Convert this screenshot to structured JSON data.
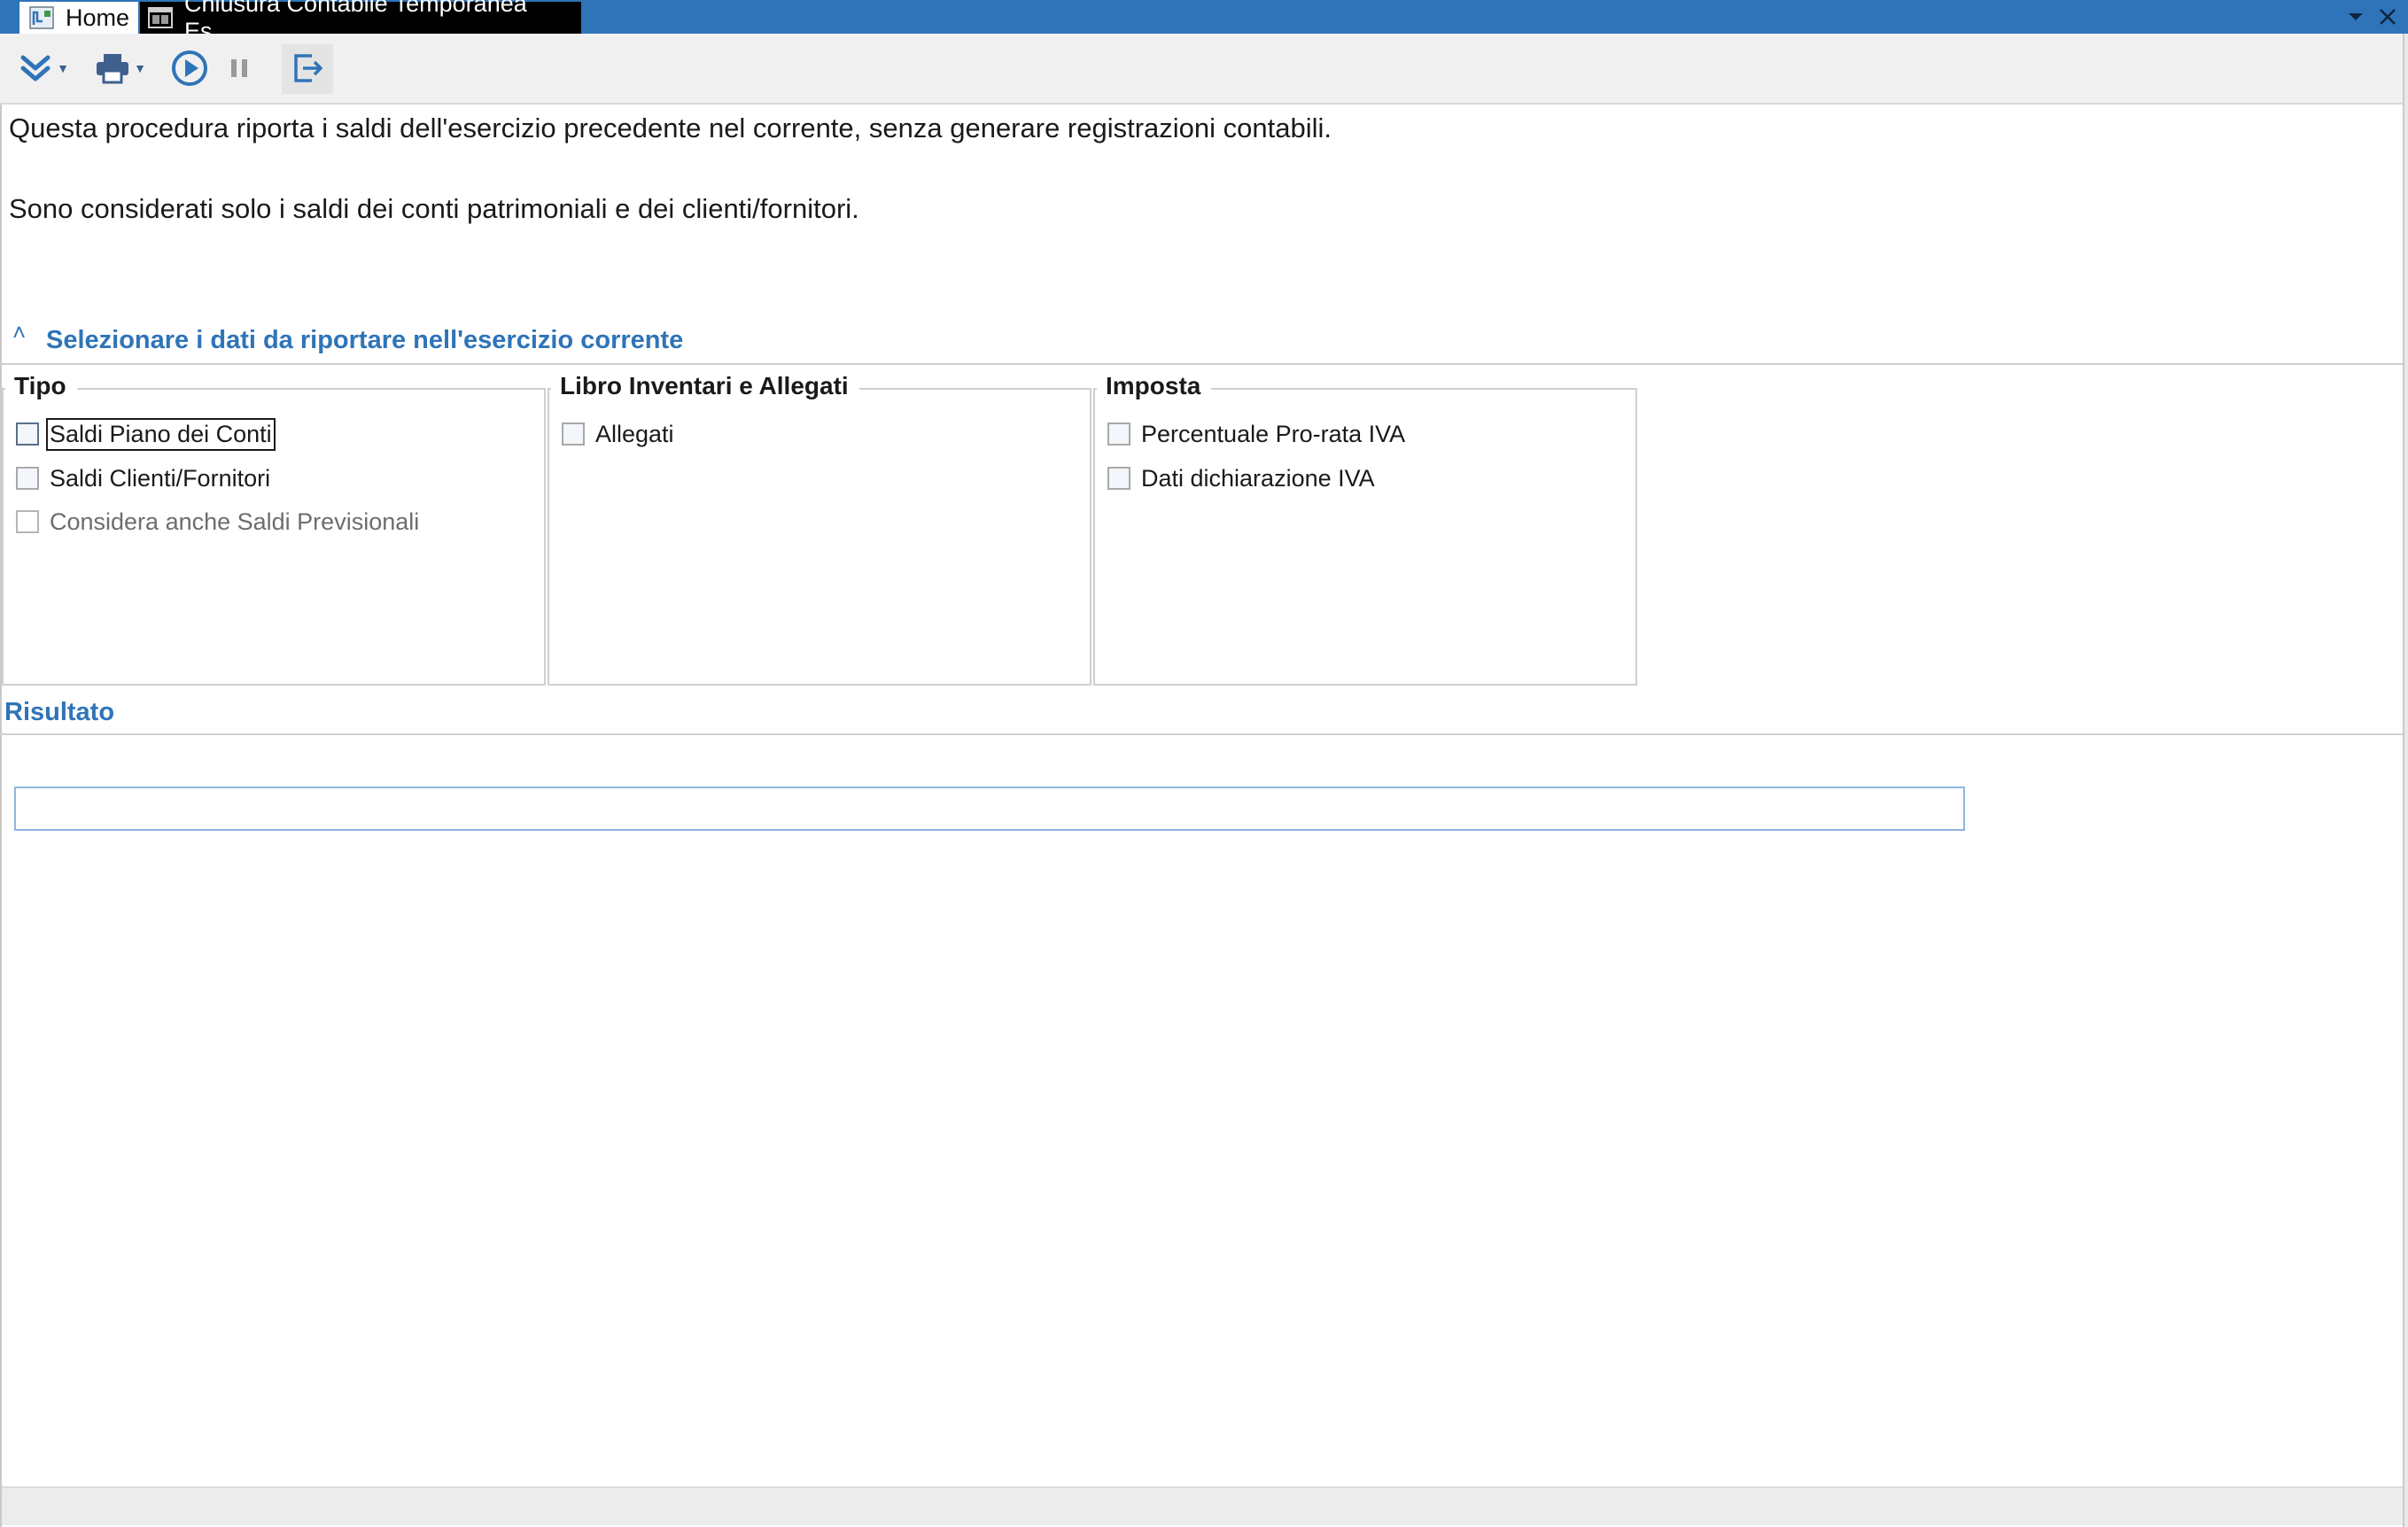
{
  "tabs": [
    {
      "label": "Home",
      "icon": "home-app-icon"
    },
    {
      "label": "Chiusura Contabile Temporanea Es...",
      "icon": "procedure-window-icon"
    }
  ],
  "toolbar": {
    "buttons": [
      {
        "name": "expand-all",
        "icon": "double-chevron-down-icon",
        "dropdown": true
      },
      {
        "name": "print",
        "icon": "printer-icon",
        "dropdown": true
      },
      {
        "name": "run",
        "icon": "play-circle-icon",
        "dropdown": false
      },
      {
        "name": "pause",
        "icon": "pause-icon",
        "dropdown": false
      },
      {
        "name": "exit",
        "icon": "exit-icon",
        "dropdown": false
      }
    ]
  },
  "description": {
    "line1": "Questa procedura riporta i saldi dell'esercizio precedente nel corrente, senza generare registrazioni contabili.",
    "line2": "Sono considerati solo i saldi dei conti patrimoniali e dei clienti/fornitori."
  },
  "section": {
    "title": "Selezionare i dati da riportare nell'esercizio corrente"
  },
  "groups": {
    "tipo": {
      "title": "Tipo",
      "items": [
        {
          "label": "Saldi Piano dei Conti",
          "checked": false,
          "enabled": true
        },
        {
          "label": "Saldi Clienti/Fornitori",
          "checked": false,
          "enabled": true
        },
        {
          "label": "Considera anche Saldi Previsionali",
          "checked": false,
          "enabled": false
        }
      ]
    },
    "libro": {
      "title": "Libro Inventari e Allegati",
      "items": [
        {
          "label": "Allegati",
          "checked": false,
          "enabled": true
        }
      ]
    },
    "imposta": {
      "title": "Imposta",
      "items": [
        {
          "label": "Percentuale Pro-rata IVA",
          "checked": false,
          "enabled": true
        },
        {
          "label": "Dati dichiarazione IVA",
          "checked": false,
          "enabled": true
        }
      ]
    }
  },
  "result": {
    "title": "Risultato",
    "value": ""
  },
  "colors": {
    "accent": "#2f74b8",
    "tabbar": "#2f74b8",
    "active_tab": "#000000"
  }
}
